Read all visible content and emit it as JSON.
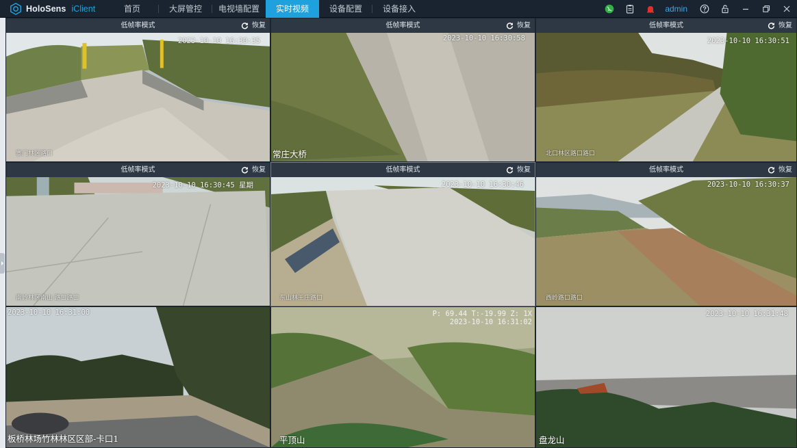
{
  "app": {
    "brand": "HoloSens",
    "brand_sub": "iClient",
    "user": "admin"
  },
  "nav": {
    "items": [
      {
        "label": "首页",
        "active": false
      },
      {
        "label": "大屏管控",
        "active": false
      },
      {
        "label": "电视墙配置",
        "active": false
      },
      {
        "label": "实时视频",
        "active": true
      },
      {
        "label": "设备配置",
        "active": false
      },
      {
        "label": "设备接入",
        "active": false
      }
    ]
  },
  "toolbar": {
    "icons": [
      "status-globe-icon",
      "clipboard-icon",
      "alarm-bell-icon",
      "help-icon",
      "lock-icon",
      "minimize-icon",
      "restore-window-icon",
      "close-icon"
    ],
    "accent": "#1ea1dc",
    "alarm_color": "#e0302a",
    "status_color": "#34b04a"
  },
  "tiles": [
    {
      "mode": "低帧率模式",
      "restore": "恢复",
      "timestamp": "2023-10-10 16:30:35",
      "osd": "寨门林区路口"
    },
    {
      "mode": "低帧率模式",
      "restore": "恢复",
      "timestamp": "2023-10-10 16:30:58",
      "camera": "常庄大桥"
    },
    {
      "mode": "低帧率模式",
      "restore": "恢复",
      "timestamp": "2023-10-10 16:30:51",
      "osd": "北口林区路口路口"
    },
    {
      "mode": "低帧率模式",
      "restore": "恢复",
      "timestamp": "2023-10-10 16:30:45 星期",
      "osd": "南岭林区南山 路口路口"
    },
    {
      "mode": "低帧率模式",
      "restore": "恢复",
      "timestamp": "2023-10-10 16:30:46",
      "osd": "东山林王庄路口"
    },
    {
      "mode": "低帧率模式",
      "restore": "恢复",
      "timestamp": "2023-10-10 16:30:37",
      "osd": "西岭路口路口"
    },
    {
      "timestamp": "2023-10-10 16:31:00",
      "camera": "板桥林场竹林林区区部-卡口1"
    },
    {
      "ptz": "P: 69.44 T:-19.99 Z: 1X",
      "timestamp": "2023-10-10 16:31:02",
      "camera": "平顶山"
    },
    {
      "timestamp": "2023-10-10 16:31:48",
      "camera": "盘龙山"
    }
  ]
}
